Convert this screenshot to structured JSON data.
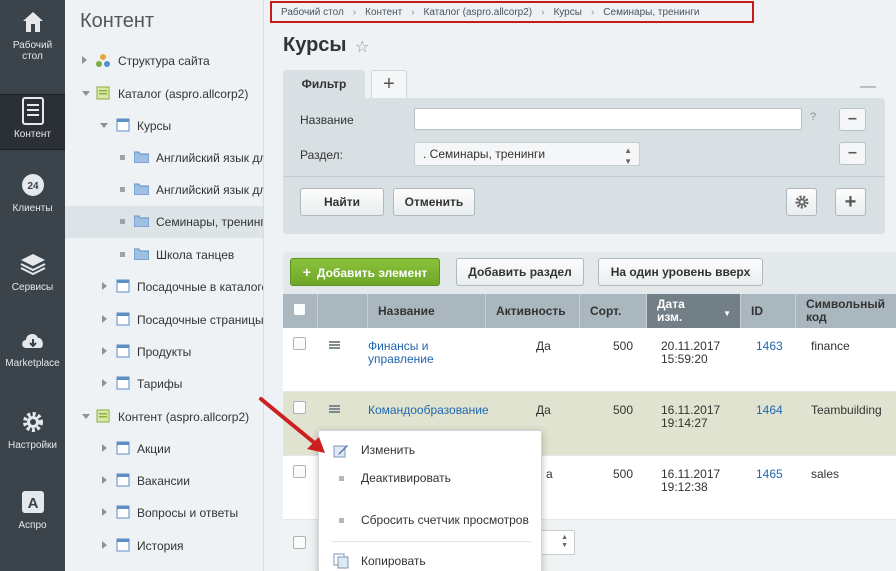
{
  "leftbar": {
    "items": [
      {
        "label": "Рабочий стол",
        "icon": "home-icon"
      },
      {
        "label": "Контент",
        "icon": "document-icon",
        "active": true
      },
      {
        "label": "Клиенты",
        "icon": "clients-24-icon"
      },
      {
        "label": "Сервисы",
        "icon": "layers-icon"
      },
      {
        "label": "Marketplace",
        "icon": "cloud-download-icon"
      },
      {
        "label": "Настройки",
        "icon": "gear-icon"
      },
      {
        "label": "Аспро",
        "icon": "aspro-a-icon"
      }
    ]
  },
  "tree": {
    "title": "Контент",
    "items": [
      {
        "label": "Структура сайта"
      },
      {
        "label": "Каталог (aspro.allcorp2)"
      },
      {
        "label": "Курсы"
      },
      {
        "label": "Английский язык дл"
      },
      {
        "label": "Английский язык дл"
      },
      {
        "label": "Семинары, тренинг"
      },
      {
        "label": "Школа танцев"
      },
      {
        "label": "Посадочные в каталоге"
      },
      {
        "label": "Посадочные страницы"
      },
      {
        "label": "Продукты"
      },
      {
        "label": "Тарифы"
      },
      {
        "label": "Контент (aspro.allcorp2)"
      },
      {
        "label": "Акции"
      },
      {
        "label": "Вакансии"
      },
      {
        "label": "Вопросы и ответы"
      },
      {
        "label": "История"
      }
    ]
  },
  "breadcrumb": {
    "items": [
      "Рабочий стол",
      "Контент",
      "Каталог (aspro.allcorp2)",
      "Курсы",
      "Семинары, тренинги"
    ],
    "separator": "›"
  },
  "page": {
    "title": "Курсы"
  },
  "filter": {
    "tab_label": "Фильтр",
    "name_label": "Название",
    "name_value": "",
    "help": "?",
    "section_label": "Раздел:",
    "section_value": ". Семинары, тренинги",
    "find_button": "Найти",
    "cancel_button": "Отменить"
  },
  "toolbar": {
    "add_element": "Добавить элемент",
    "add_section": "Добавить раздел",
    "level_up": "На один уровень вверх"
  },
  "table": {
    "columns": {
      "name": "Название",
      "active": "Активность",
      "sort": "Сорт.",
      "date": "Дата изм.",
      "id": "ID",
      "code": "Символьный код"
    },
    "rows": [
      {
        "name": "Финансы и управление",
        "active": "Да",
        "sort": "500",
        "date": "20.11.2017",
        "time": "15:59:20",
        "id": "1463",
        "code": "finance"
      },
      {
        "name": "Командообразование",
        "active": "Да",
        "sort": "500",
        "date": "16.11.2017",
        "time": "19:14:27",
        "id": "1464",
        "code": "Teambuilding"
      },
      {
        "name": "",
        "active": "а",
        "sort": "500",
        "date": "16.11.2017",
        "time": "19:12:38",
        "id": "1465",
        "code": "sales"
      }
    ]
  },
  "context_menu": {
    "items": [
      "Изменить",
      "Деактивировать",
      "Сбросить счетчик просмотров",
      "Копировать"
    ]
  },
  "colors": {
    "accent_red": "#c91a1a",
    "green_button": "#7bb432",
    "link": "#2067b0",
    "sidebar_bg": "#3b434b"
  }
}
